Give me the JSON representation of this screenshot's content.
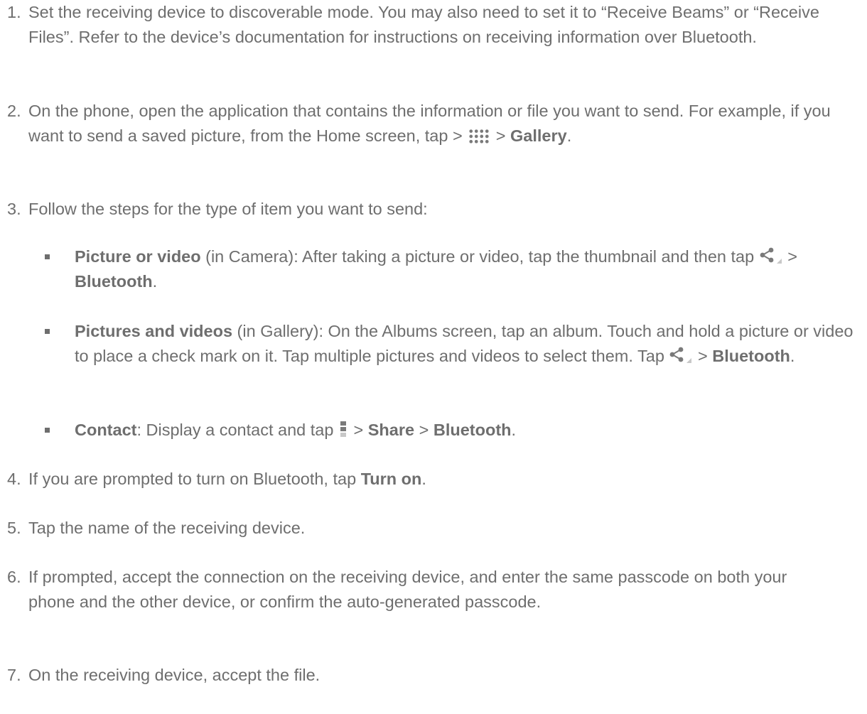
{
  "steps": [
    {
      "num": "1.",
      "text": "Set the receiving device to discoverable mode. You may also need to set it to “Receive Beams” or “Receive Files”. Refer to the device’s documentation for instructions on receiving information over Bluetooth."
    },
    {
      "num": "2.",
      "text_before": "On the phone, open the application that contains the information or file you want to send. For example, if you want to send a saved picture, from the Home screen, tap >",
      "text_sep": " > ",
      "bold": "Gallery",
      "text_after": ".",
      "icon": "apps-grid-icon"
    },
    {
      "num": "3.",
      "text": "Follow the steps for the type of item you want to send:",
      "substeps": [
        {
          "bold": "Picture or video",
          "text": " (in Camera): After taking a picture or video, tap the thumbnail and then tap ",
          "sep": " > ",
          "bold2": "Bluetooth",
          "end": ".",
          "icon": "share-icon"
        },
        {
          "bold": "Pictures and videos",
          "text": " (in Gallery): On the Albums screen, tap an album. Touch and hold a picture or video to place a check mark on it. Tap multiple pictures and videos to select them. Tap ",
          "sep": " > ",
          "bold2": "Bluetooth",
          "end": ".",
          "icon": "share-icon"
        },
        {
          "bold": "Contact",
          "text": ": Display a contact and tap ",
          "sep": " > ",
          "bold2": "Share",
          "sep2": " > ",
          "bold3": "Bluetooth",
          "end": ".",
          "icon": "menu-icon"
        }
      ]
    },
    {
      "num": "4.",
      "text": "If you are prompted to turn on Bluetooth, tap ",
      "bold": "Turn on",
      "end": "."
    },
    {
      "num": "5.",
      "text": "Tap the name of the receiving device."
    },
    {
      "num": "6.",
      "text": "If prompted, accept the connection on the receiving device, and enter the same passcode on both your phone and the other device, or confirm the auto-generated passcode."
    },
    {
      "num": "7.",
      "text": "On the receiving device, accept the file."
    }
  ]
}
